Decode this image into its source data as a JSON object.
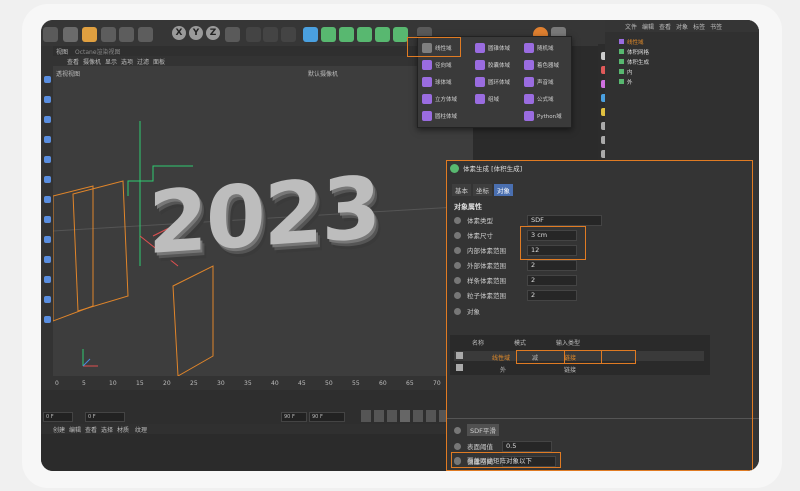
{
  "toolbar": {
    "xyz": [
      "X",
      "Y",
      "Z"
    ]
  },
  "viewport": {
    "tab_label": "视图",
    "title_bar": "Octane渲染视图",
    "menu": [
      "查看",
      "摄像机",
      "显示",
      "选项",
      "过滤",
      "面板"
    ],
    "view_name": "透视视图",
    "camera": "默认摄像机",
    "text_3d": "2023"
  },
  "ruler": {
    "ticks": [
      "0",
      "5",
      "10",
      "15",
      "20",
      "25",
      "30",
      "35",
      "40",
      "45",
      "50",
      "55",
      "60",
      "65",
      "70"
    ]
  },
  "timeline": {
    "start_frame": "0 F",
    "current_frame": "0 F",
    "end_frame1": "90 F",
    "end_frame2": "90 F"
  },
  "bottom_menu": [
    "创建",
    "编辑",
    "查看",
    "选择",
    "材质",
    "纹理"
  ],
  "dropdown": {
    "items": [
      {
        "label": "线性域",
        "color": "#9a6ce0"
      },
      {
        "label": "圆锥体域",
        "color": "#9a6ce0"
      },
      {
        "label": "随机域",
        "color": "#9a6ce0"
      },
      {
        "label": "径向域",
        "color": "#9a6ce0"
      },
      {
        "label": "胶囊体域",
        "color": "#9a6ce0"
      },
      {
        "label": "着色器域",
        "color": "#9a6ce0"
      },
      {
        "label": "球体域",
        "color": "#9a6ce0"
      },
      {
        "label": "圆环体域",
        "color": "#9a6ce0"
      },
      {
        "label": "声音域",
        "color": "#9a6ce0"
      },
      {
        "label": "立方体域",
        "color": "#9a6ce0"
      },
      {
        "label": "组域",
        "color": "#9a6ce0"
      },
      {
        "label": "公式域",
        "color": "#9a6ce0"
      },
      {
        "label": "圆柱体域",
        "color": "#9a6ce0"
      },
      {
        "label": "Python域",
        "color": "#9a6ce0"
      }
    ]
  },
  "scene": {
    "menu": [
      "文件",
      "编辑",
      "查看",
      "对象",
      "标签",
      "书签"
    ],
    "rows": [
      "线性域",
      "体积网格",
      "体积生成",
      "内",
      "外"
    ]
  },
  "attributes": {
    "title": "体素生成 [体积生成]",
    "tabs": [
      "基本",
      "坐标",
      "对象"
    ],
    "section": "对象属性",
    "voxel_type_label": "体素类型",
    "voxel_type_value": "SDF",
    "voxel_size_label": "体素尺寸",
    "voxel_size_value": "3 cm",
    "inner_range_label": "内部体素范围",
    "inner_range_value": "12",
    "outer_range_label": "外部体素范围",
    "outer_range_value": "2",
    "spline_range_label": "样条体素范围",
    "spline_range_value": "2",
    "particle_range_label": "粒子体素范围",
    "particle_range_value": "2",
    "objects_label": "对象",
    "table_headers": [
      "名称",
      "模式",
      "输入类型"
    ],
    "table_rows": [
      {
        "name": "线性域",
        "mode": "减",
        "input": "链接"
      },
      {
        "name": "外",
        "mode": "",
        "input": "链接"
      }
    ],
    "sdf_smooth": "SDF平滑",
    "surface_threshold_label": "表面阈值",
    "surface_threshold_value": "0.5",
    "create_space_label": "创建空间",
    "create_space_value": "对象以下",
    "cover_label": "覆盖网格矩阵"
  },
  "colors": {
    "highlight": "#e07b23",
    "accent_tab": "#4a6fb0"
  }
}
